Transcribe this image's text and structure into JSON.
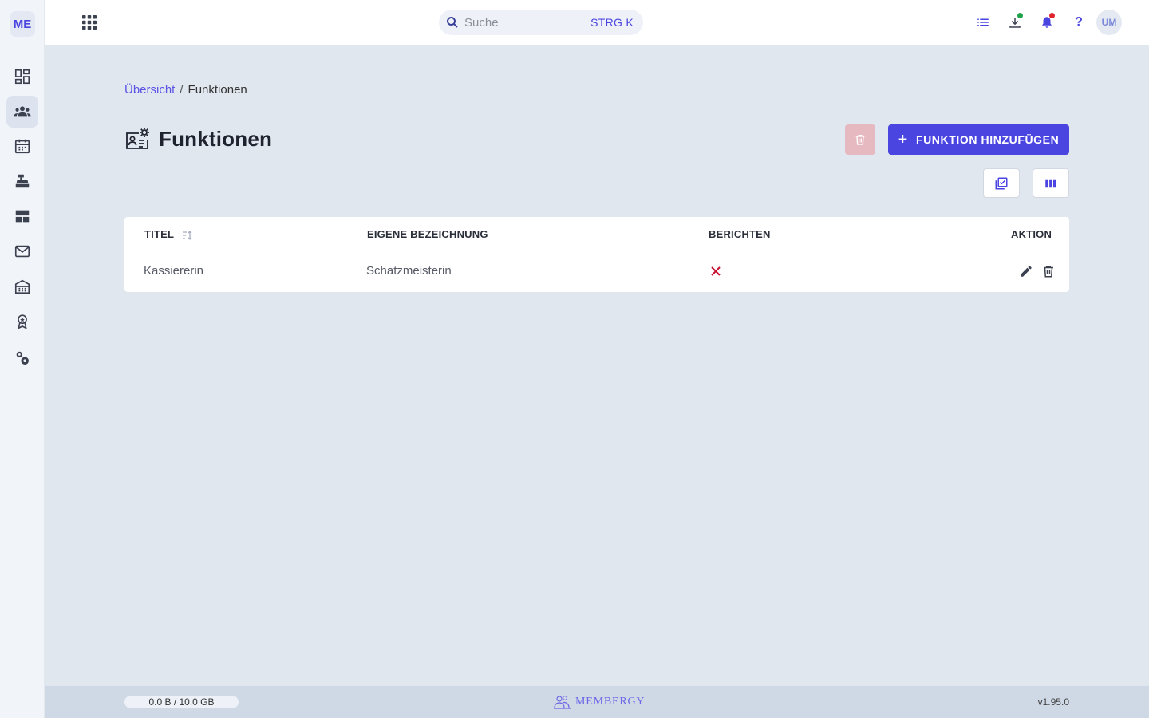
{
  "app": {
    "logo_text": "ME"
  },
  "sidebar": {
    "items": [
      {
        "icon": "dashboard-icon"
      },
      {
        "icon": "members-icon",
        "active": true
      },
      {
        "icon": "calendar-icon"
      },
      {
        "icon": "cash-register-icon"
      },
      {
        "icon": "layout-icon"
      },
      {
        "icon": "mail-icon"
      },
      {
        "icon": "building-icon"
      },
      {
        "icon": "award-icon"
      },
      {
        "icon": "settings-icon"
      }
    ]
  },
  "topbar": {
    "search_placeholder": "Suche",
    "search_shortcut": "STRG K",
    "help_label": "?",
    "avatar_initials": "UM"
  },
  "breadcrumb": {
    "link": "Übersicht",
    "separator": "/",
    "current": "Funktionen"
  },
  "page": {
    "title": "Funktionen",
    "add_button": "FUNKTION HINZUFÜGEN"
  },
  "table": {
    "columns": [
      "TITEL",
      "EIGENE BEZEICHNUNG",
      "BERICHTEN",
      "AKTION"
    ],
    "rows": [
      {
        "title": "Kassiererin",
        "custom_name": "Schatzmeisterin",
        "report": false
      }
    ]
  },
  "footer": {
    "storage": "0.0 B / 10.0 GB",
    "brand": "MEMBERGY",
    "version": "v1.95.0"
  },
  "colors": {
    "primary": "#4a44e0",
    "danger": "#c8102e",
    "disabled_danger": "#e6b9c0"
  }
}
